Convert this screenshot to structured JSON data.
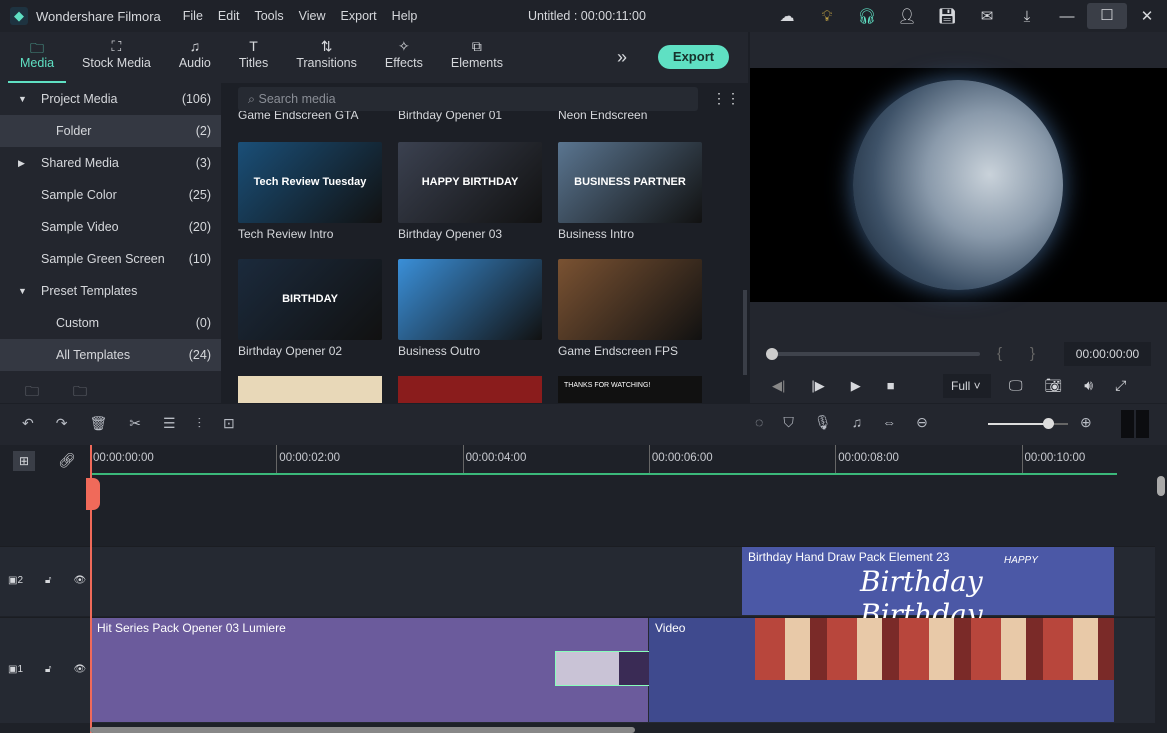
{
  "app": {
    "name": "Wondershare Filmora",
    "title": "Untitled : 00:00:11:00",
    "menu": [
      "File",
      "Edit",
      "Tools",
      "View",
      "Export",
      "Help"
    ]
  },
  "tabs": [
    {
      "label": "Media",
      "icon": "folder-icon",
      "active": true
    },
    {
      "label": "Stock Media",
      "icon": "stock-icon"
    },
    {
      "label": "Audio",
      "icon": "music-icon"
    },
    {
      "label": "Titles",
      "icon": "text-icon"
    },
    {
      "label": "Transitions",
      "icon": "transition-icon"
    },
    {
      "label": "Effects",
      "icon": "effects-icon"
    },
    {
      "label": "Elements",
      "icon": "elements-icon"
    }
  ],
  "export_label": "Export",
  "sidebar": [
    {
      "label": "Project Media",
      "count": "(106)",
      "arrow": "▼"
    },
    {
      "label": "Folder",
      "count": "(2)",
      "sub": true,
      "sel": true
    },
    {
      "label": "Shared Media",
      "count": "(3)",
      "arrow": "▶"
    },
    {
      "label": "Sample Color",
      "count": "(25)"
    },
    {
      "label": "Sample Video",
      "count": "(20)"
    },
    {
      "label": "Sample Green Screen",
      "count": "(10)"
    },
    {
      "label": "Preset Templates",
      "count": "",
      "arrow": "▼"
    },
    {
      "label": "Custom",
      "count": "(0)",
      "sub": true
    },
    {
      "label": "All Templates",
      "count": "(24)",
      "sub": true,
      "sel": true
    }
  ],
  "search_placeholder": "Search media",
  "media_top": [
    "Game Endscreen GTA",
    "Birthday Opener 01",
    "Neon Endscreen"
  ],
  "media": [
    {
      "label": "Tech Review Intro",
      "overlay": "Tech Review Tuesday",
      "bg": "#1a4f78"
    },
    {
      "label": "Birthday Opener 03",
      "overlay": "HAPPY BIRTHDAY",
      "bg": "#3b4150"
    },
    {
      "label": "Business Intro",
      "overlay": "BUSINESS PARTNER",
      "bg": "#5a7590"
    },
    {
      "label": "Birthday Opener 02",
      "overlay": "BIRTHDAY",
      "bg": "#1b2a3c"
    },
    {
      "label": "Business Outro",
      "overlay": "",
      "bg": "#3a8fd8"
    },
    {
      "label": "Game Endscreen FPS",
      "overlay": "",
      "bg": "#7a5232"
    }
  ],
  "media_bottom_overlay": "THANKS FOR WATCHING!",
  "preview": {
    "timecode": "00:00:00:00",
    "quality": "Full",
    "progress": 0
  },
  "ruler": [
    "00:00:00:00",
    "00:00:02:00",
    "00:00:04:00",
    "00:00:06:00",
    "00:00:08:00",
    "00:00:10:00"
  ],
  "tracks": {
    "t2": "2",
    "t1": "1"
  },
  "clips": {
    "element": "Birthday Hand Draw Pack Element 23",
    "element_text": "Birthday Birthday",
    "element_small": "HAPPY",
    "title": "Hit Series Pack Opener 03 Lumiere",
    "video": "Video"
  },
  "zoom_level": 0.75,
  "colors": {
    "accent": "#5fe0c3",
    "purple_clip": "#6b5b9c",
    "blue_clip": "#4b58a6",
    "playhead": "#f06a5a"
  }
}
